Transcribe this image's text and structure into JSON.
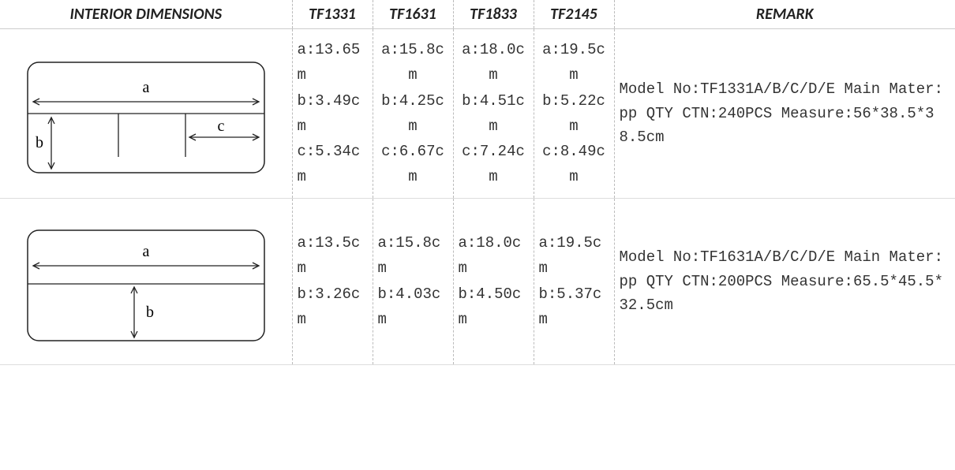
{
  "chart_data": {
    "type": "table",
    "headers": [
      "INTERIOR DIMENSIONS",
      "TF1331",
      "TF1631",
      "TF1833",
      "TF2145",
      "REMARK"
    ],
    "rows": [
      {
        "diagram": "abc",
        "TF1331": {
          "a": "13.65m",
          "b": "3.49cm",
          "c": "5.34cm"
        },
        "TF1631": {
          "a": "15.8cm",
          "b": "4.25cm",
          "c": "6.67cm"
        },
        "TF1833": {
          "a": "18.0cm",
          "b": "4.51cm",
          "c": "7.24cm"
        },
        "TF2145": {
          "a": "19.5cm",
          "b": "5.22cm",
          "c": "8.49cm"
        },
        "remark": {
          "model_no": "TF1331A/B/C/D/E",
          "main_mater": "pp",
          "qty_ctn": "240PCS",
          "measure": "56*38.5*38.5cm"
        }
      },
      {
        "diagram": "ab",
        "TF1331": {
          "a": "13.5cm",
          "b": "3.26cm"
        },
        "TF1631": {
          "a": "15.8cm",
          "b": "4.03cm"
        },
        "TF1833": {
          "a": "18.0cm",
          "b": "4.50cm"
        },
        "TF2145": {
          "a": "19.5cm",
          "b": "5.37cm"
        },
        "remark": {
          "model_no": "TF1631A/B/C/D/E",
          "main_mater": "pp",
          "qty_ctn": "200PCS",
          "measure": "65.5*45.5*32.5cm"
        }
      }
    ]
  },
  "headers": {
    "interior_dimensions": "INTERIOR DIMENSIONS",
    "tf1331": "TF1331",
    "tf1631": "TF1631",
    "tf1833": "TF1833",
    "tf2145": "TF2145",
    "remark": "REMARK"
  },
  "rows": [
    {
      "tf1331": "a:13.65m\nb:3.49cm\nc:5.34cm",
      "tf1631": "a:15.8cm\nb:4.25cm\nc:6.67cm",
      "tf1833": "a:18.0cm\nb:4.51cm\nc:7.24cm",
      "tf2145": "a:19.5cm\nb:5.22cm\nc:8.49cm",
      "remark": "Model No:TF1331A/B/C/D/E\nMain Mater:pp\nQTY CTN:240PCS\nMeasure:56*38.5*38.5cm"
    },
    {
      "tf1331": "a:13.5cm\nb:3.26cm",
      "tf1631": "a:15.8cm\nb:4.03cm",
      "tf1833": "a:18.0cm\nb:4.50cm",
      "tf2145": "a:19.5cm\nb:5.37cm",
      "remark": "Model No:TF1631A/B/C/D/E\nMain Mater:pp\nQTY CTN:200PCS\nMeasure:65.5*45.5*32.5cm"
    }
  ],
  "diagram_labels": {
    "a": "a",
    "b": "b",
    "c": "c"
  }
}
